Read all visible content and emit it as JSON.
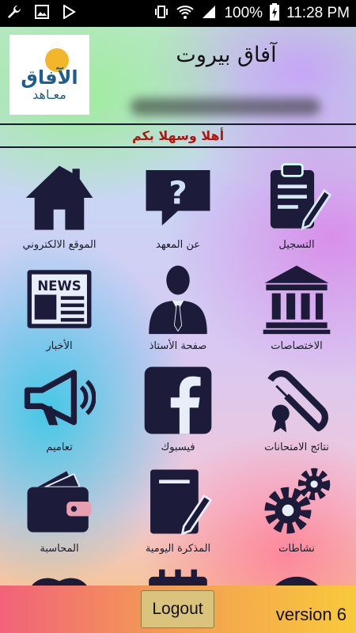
{
  "status_bar": {
    "battery": "100%",
    "time": "11:28 PM",
    "icons": [
      "wrench-icon",
      "image-icon",
      "play-store-icon",
      "vibrate-icon",
      "wifi-icon",
      "signal-icon",
      "battery-charging-icon"
    ]
  },
  "header": {
    "title": "آفاق بيروت",
    "logo_main": "الآفاق",
    "logo_sub": "معـاهد"
  },
  "welcome": "أهلا وسهلا بكم",
  "grid": {
    "items": [
      {
        "label": "التسجيل",
        "icon": "clipboard-pencil-icon"
      },
      {
        "label": "عن المعهد",
        "icon": "question-chat-icon"
      },
      {
        "label": "الموقع الالكتروني",
        "icon": "home-icon"
      },
      {
        "label": "الاختصاصات",
        "icon": "institution-icon"
      },
      {
        "label": "صفحة الأستاذ",
        "icon": "teacher-icon"
      },
      {
        "label": "الأخبار",
        "icon": "newspaper-icon"
      },
      {
        "label": "نتائج الامتحانات",
        "icon": "diploma-icon"
      },
      {
        "label": "فيسبوك",
        "icon": "facebook-icon"
      },
      {
        "label": "تعاميم",
        "icon": "megaphone-icon"
      },
      {
        "label": "نشاطات",
        "icon": "gears-icon"
      },
      {
        "label": "المذكرة اليومية",
        "icon": "notebook-pencil-icon"
      },
      {
        "label": "المحاسبة",
        "icon": "wallet-icon"
      }
    ]
  },
  "footer": {
    "logout_label": "Logout",
    "version": "version 6"
  },
  "colors": {
    "icon": "#1c1c3a",
    "welcome_text": "#b01515",
    "logout_bg": "#d9c37d"
  }
}
